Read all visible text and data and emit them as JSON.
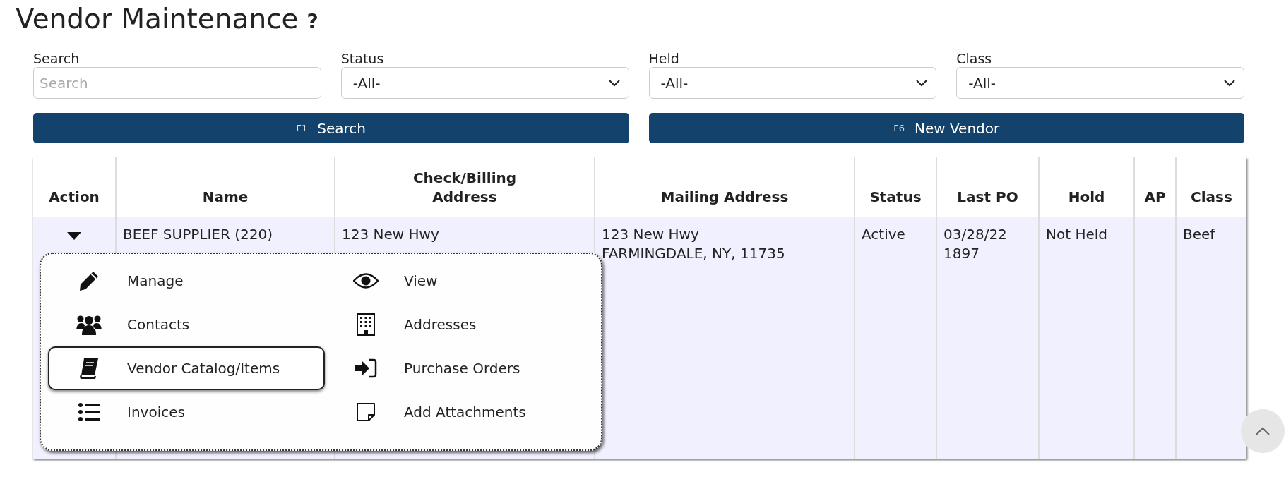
{
  "page": {
    "title": "Vendor Maintenance",
    "help": "?"
  },
  "filters": [
    {
      "label": "Search",
      "kind": "text",
      "placeholder": "Search"
    },
    {
      "label": "Status",
      "kind": "select",
      "value": "-All-"
    },
    {
      "label": "Held",
      "kind": "select",
      "value": "-All-"
    },
    {
      "label": "Class",
      "kind": "select",
      "value": "-All-"
    }
  ],
  "buttons": [
    {
      "key": "F1",
      "label": "Search"
    },
    {
      "key": "F6",
      "label": "New Vendor"
    }
  ],
  "table": {
    "columns": [
      "Action",
      "Name",
      "Check/Billing Address",
      "Mailing Address",
      "Status",
      "Last PO",
      "Hold",
      "AP",
      "Class"
    ],
    "rows": [
      {
        "cells": [
          null,
          [
            "BEEF SUPPLIER (220)"
          ],
          [
            "123 New Hwy"
          ],
          [
            "123 New Hwy",
            "FARMINGDALE, NY, 11735"
          ],
          [
            "Active"
          ],
          [
            "03/28/22",
            "1897"
          ],
          [
            "Not Held"
          ],
          null,
          [
            "Beef"
          ]
        ],
        "expanded": true
      }
    ]
  },
  "action_menu": {
    "items": [
      {
        "label": "Manage",
        "kind": "pencil",
        "selected": false
      },
      {
        "label": "View",
        "kind": "eye",
        "selected": false
      },
      {
        "label": "Contacts",
        "kind": "users",
        "selected": false
      },
      {
        "label": "Addresses",
        "kind": "building",
        "selected": false
      },
      {
        "label": "Vendor Catalog/Items",
        "kind": "book",
        "selected": true
      },
      {
        "label": "Purchase Orders",
        "kind": "signin",
        "selected": false
      },
      {
        "label": "Invoices",
        "kind": "list",
        "selected": false
      },
      {
        "label": "Add Attachments",
        "kind": "note",
        "selected": false
      }
    ]
  }
}
